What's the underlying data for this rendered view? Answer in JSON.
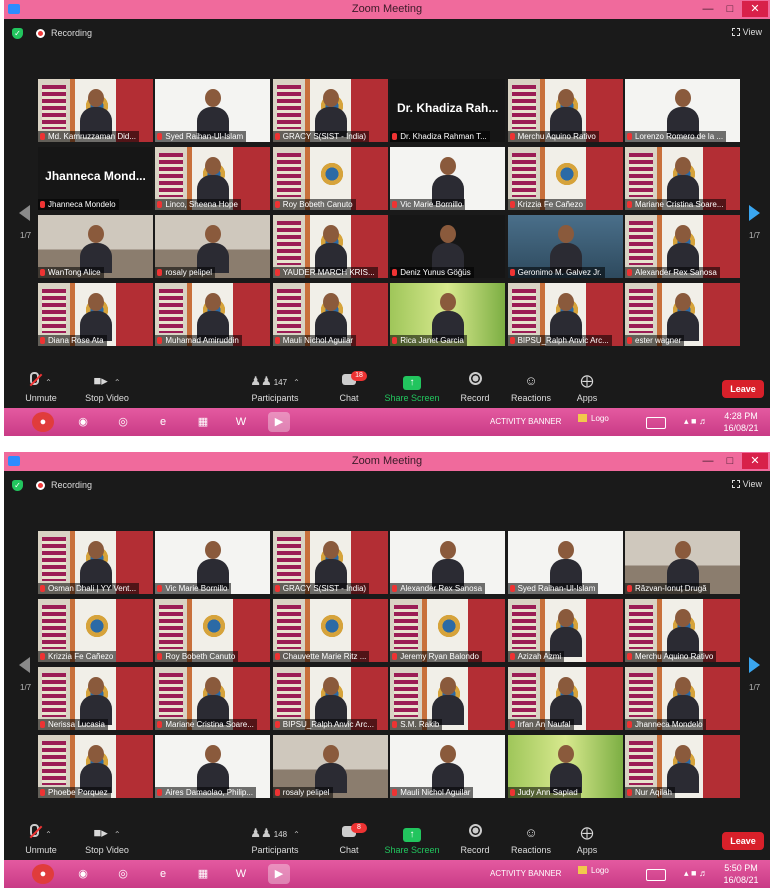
{
  "shots": [
    {
      "window_title": "Zoom Meeting",
      "recording_label": "Recording",
      "view_label": "View",
      "page_left": "1/7",
      "page_right": "1/7",
      "tiles": [
        {
          "name": "Md. Kamruzzaman Did...",
          "bg": "banner",
          "active": true,
          "person": true
        },
        {
          "name": "Syed Raihan-Ul-Islam",
          "bg": "white",
          "person": true
        },
        {
          "name": "GRACY S(SIST - India)",
          "bg": "banner",
          "person": true
        },
        {
          "name": "Dr. Khadiza Rahman T...",
          "bg": "dark",
          "bigname": "Dr. Khadiza Rah..."
        },
        {
          "name": "Merchu Aquino Rativo",
          "bg": "banner",
          "person": true
        },
        {
          "name": "Lorenzo Romero de la ...",
          "bg": "white",
          "person": true
        },
        {
          "name": "Jhanneca Mondelo",
          "bg": "dark",
          "bigname": "Jhanneca Mond..."
        },
        {
          "name": "Linco, Sheena Hope",
          "bg": "banner",
          "person": true
        },
        {
          "name": "Roy Bobeth Canuto",
          "bg": "banner"
        },
        {
          "name": "Vic Marie Bornillo",
          "bg": "white",
          "person": true
        },
        {
          "name": "Krizzia Fe Cañezo",
          "bg": "banner"
        },
        {
          "name": "Mariane Cristina Soare...",
          "bg": "banner",
          "person": true
        },
        {
          "name": "WanTong Alice",
          "bg": "room",
          "person": true
        },
        {
          "name": "rosaly pelipel",
          "bg": "room",
          "person": true
        },
        {
          "name": "YAUDER MARCH KRIS...",
          "bg": "banner",
          "person": true
        },
        {
          "name": "Deniz Yunus Göğüs",
          "bg": "dark",
          "person": true
        },
        {
          "name": "Geronimo M. Galvez Jr.",
          "bg": "blue",
          "person": true
        },
        {
          "name": "Alexander Rex Sanosa",
          "bg": "banner",
          "person": true
        },
        {
          "name": "Diana Rose Ata",
          "bg": "banner",
          "person": true
        },
        {
          "name": "Muhamad Amiruddin",
          "bg": "banner",
          "person": true
        },
        {
          "name": "Mauli Nichol Aguilar",
          "bg": "banner",
          "person": true
        },
        {
          "name": "Rica Janet Garcia",
          "bg": "green",
          "person": true
        },
        {
          "name": "BIPSU_Ralph Anvic Arc...",
          "bg": "banner",
          "person": true
        },
        {
          "name": "ester wagner",
          "bg": "banner",
          "person": true
        }
      ],
      "toolbar": {
        "unmute": "Unmute",
        "stop_video": "Stop Video",
        "participants": "Participants",
        "participants_count": "147",
        "chat": "Chat",
        "chat_badge": "18",
        "share_screen": "Share Screen",
        "record": "Record",
        "reactions": "Reactions",
        "apps": "Apps",
        "leave": "Leave"
      },
      "taskbar": {
        "activity_banner": "ACTIVITY BANNER",
        "logo": "Logo",
        "time": "4:28 PM",
        "date": "16/08/21"
      }
    },
    {
      "window_title": "Zoom Meeting",
      "recording_label": "Recording",
      "view_label": "View",
      "page_left": "1/7",
      "page_right": "1/7",
      "tiles": [
        {
          "name": "Osman Dhali | YY Vent...",
          "bg": "banner",
          "active": true,
          "person": true
        },
        {
          "name": "Vic Marie Bornillo",
          "bg": "white",
          "person": true
        },
        {
          "name": "GRACY S(SIST - India)",
          "bg": "banner",
          "person": true
        },
        {
          "name": "Alexander Rex Sanosa",
          "bg": "white",
          "person": true
        },
        {
          "name": "Syed Raihan-Ul-Islam",
          "bg": "white",
          "person": true
        },
        {
          "name": "Răzvan-Ionuț Drugă",
          "bg": "room",
          "person": true
        },
        {
          "name": "Krizzia Fe Cañezo",
          "bg": "banner"
        },
        {
          "name": "Roy Bobeth Canuto",
          "bg": "banner"
        },
        {
          "name": "Chauvette Marie Ritz ...",
          "bg": "banner"
        },
        {
          "name": "Jeremy Ryan Balondo",
          "bg": "banner"
        },
        {
          "name": "Azizah Azmi",
          "bg": "banner",
          "person": true
        },
        {
          "name": "Merchu Aquino Rativo",
          "bg": "banner",
          "person": true
        },
        {
          "name": "Nerissa Lucasia",
          "bg": "banner",
          "person": true
        },
        {
          "name": "Mariane Cristina Soare...",
          "bg": "banner",
          "person": true
        },
        {
          "name": "BIPSU_Ralph Anvic Arc...",
          "bg": "banner",
          "person": true
        },
        {
          "name": "S.M. Rakib",
          "bg": "banner",
          "person": true
        },
        {
          "name": "Irfan An Naufal",
          "bg": "banner",
          "person": true
        },
        {
          "name": "Jhanneca Mondelo",
          "bg": "banner",
          "person": true
        },
        {
          "name": "Phoebe Porquez",
          "bg": "banner",
          "person": true
        },
        {
          "name": "Aires Damaolao, Philip...",
          "bg": "white",
          "person": true
        },
        {
          "name": "rosaly pelipel",
          "bg": "room",
          "person": true
        },
        {
          "name": "Mauli Nichol Aguilar",
          "bg": "white",
          "person": true
        },
        {
          "name": "Judy Ann Saplad",
          "bg": "green",
          "person": true
        },
        {
          "name": "Nur Aqilah",
          "bg": "banner",
          "person": true
        }
      ],
      "toolbar": {
        "unmute": "Unmute",
        "stop_video": "Stop Video",
        "participants": "Participants",
        "participants_count": "148",
        "chat": "Chat",
        "chat_badge": "8",
        "share_screen": "Share Screen",
        "record": "Record",
        "reactions": "Reactions",
        "apps": "Apps",
        "leave": "Leave"
      },
      "taskbar": {
        "activity_banner": "ACTIVITY BANNER",
        "logo": "Logo",
        "time": "5:50 PM",
        "date": "16/08/21"
      }
    }
  ]
}
